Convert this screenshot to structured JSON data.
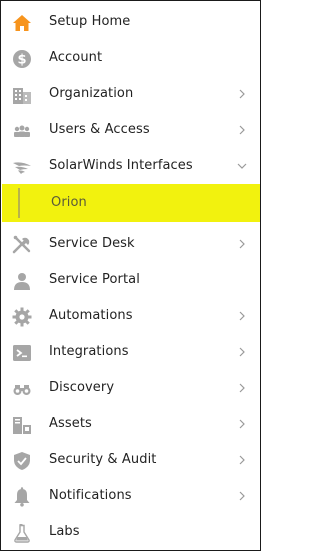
{
  "menu": {
    "items": [
      {
        "label": "Setup Home",
        "icon": "home-icon"
      },
      {
        "label": "Account",
        "icon": "dollar-coin-icon"
      },
      {
        "label": "Organization",
        "icon": "building-icon"
      },
      {
        "label": "Users & Access",
        "icon": "users-icon"
      },
      {
        "label": "SolarWinds Interfaces",
        "icon": "solarwinds-icon"
      },
      {
        "label": "Orion",
        "icon": ""
      },
      {
        "label": "Service Desk",
        "icon": "tools-icon"
      },
      {
        "label": "Service Portal",
        "icon": "person-icon"
      },
      {
        "label": "Automations",
        "icon": "gear-icon"
      },
      {
        "label": "Integrations",
        "icon": "terminal-icon"
      },
      {
        "label": "Discovery",
        "icon": "binoculars-icon"
      },
      {
        "label": "Assets",
        "icon": "assets-icon"
      },
      {
        "label": "Security & Audit",
        "icon": "shield-icon"
      },
      {
        "label": "Notifications",
        "icon": "bell-icon"
      },
      {
        "label": "Labs",
        "icon": "flask-icon"
      }
    ]
  },
  "colors": {
    "accent_home": "#f7941d",
    "icon_gray": "#a6a6a6",
    "highlight": "#f2f20e"
  }
}
